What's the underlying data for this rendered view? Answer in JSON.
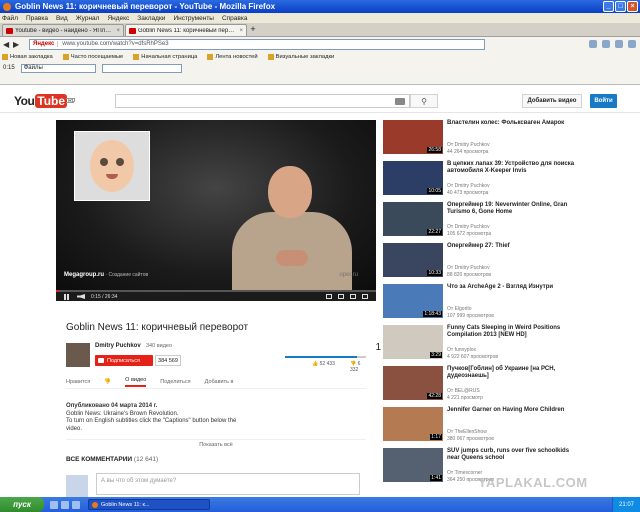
{
  "window": {
    "title": "Goblin News 11: коричневый переворот - YouTube - Mozilla Firefox"
  },
  "menu": [
    "Файл",
    "Правка",
    "Вид",
    "Журнал",
    "Яндекс",
    "Закладки",
    "Инструменты",
    "Справка"
  ],
  "tabs": [
    {
      "label": "Youtube - видео - найдено - ЯПлакалъ"
    },
    {
      "label": "Goblin News 11: коричневый перев..."
    }
  ],
  "address": {
    "badge": "Яндекс",
    "url": "www.youtube.com/watch?v=dfsRhPSe3"
  },
  "bookmarks": [
    "Новая закладка",
    "Часто посещаемые",
    "Начальная страница",
    "Лента новостей",
    "Визуальные закладки"
  ],
  "toolbar2": {
    "field_label": "Файлы",
    "time": "0:15"
  },
  "youtube": {
    "logo": {
      "you": "You",
      "tube": "Tube",
      "locale": "RU"
    },
    "upload_label": "Добавить видео",
    "login_label": "Войти"
  },
  "player": {
    "time": "0:15 / 26:34",
    "brand": "Megagroup.ru",
    "brand_sub": "Создание сайтов",
    "watermark": "oper.ru",
    "progress": 0.01
  },
  "video": {
    "title": "Goblin News 11: коричневый переворот",
    "channel": "Dmitry Puchkov",
    "video_count": "340 видео",
    "subscribe_label": "Подписаться",
    "subscriber_count": "384 569",
    "views": "1 238 833",
    "likes": "52 433",
    "dislikes": "6 332",
    "like_ratio": 0.89
  },
  "actions": [
    "Нравится",
    "О видео",
    "Поделиться",
    "Добавить в"
  ],
  "description": {
    "published": "Опубликовано 04 марта 2014 г.",
    "lines": [
      "Goblin News: Ukraine's Brown Revolution.",
      "To turn on English subtitles click the \"Captions\" button below the",
      "video."
    ],
    "show_more": "Показать всё"
  },
  "comments": {
    "header": "ВСЕ КОММЕНТАРИИ",
    "count": "(12 641)",
    "placeholder": "А вы что об этом думаете?"
  },
  "sidebar": [
    {
      "title": "Властелин колес: Фольксваген Амарок",
      "channel": "От Dmitry Puchkov",
      "views": "44 264 просмотра",
      "duration": "26:58",
      "color": "#9a3a2a"
    },
    {
      "title": "В цепких лапах 39: Устройство для поиска автомобиля X-Keeper Invis",
      "channel": "От Dmitry Puchkov",
      "views": "40 473 просмотра",
      "duration": "10:05",
      "color": "#2c3e66"
    },
    {
      "title": "Опергеймер 19: Neverwinter Online, Gran Turismo 6, Gone Home",
      "channel": "От Dmitry Puchkov",
      "views": "105 672 просмотра",
      "duration": "22:27",
      "color": "#3b4a5a"
    },
    {
      "title": "Опергеймер 27: Thief",
      "channel": "От Dmitry Puchkov",
      "views": "88 820 просмотров",
      "duration": "10:33",
      "color": "#3a4660"
    },
    {
      "title": "Что за ArcheAge 2 - Взгляд Изнутри",
      "channel": "От Elgorito",
      "views": "107 999 просмотров",
      "duration": "1:18:43",
      "color": "#4a7ab8"
    },
    {
      "title": "Funny Cats Sleeping in Weird Positions Compilation 2013 [NEW HD]",
      "channel": "От funnyplox",
      "views": "4 922 607 просмотров",
      "duration": "3:29",
      "color": "#cfc9c0"
    },
    {
      "title": "Пучков[Гоблин] об Украине [на РСН, дудеознаешь]",
      "channel": "От BEL@RUS",
      "views": "4 221 просмотр",
      "duration": "42:28",
      "color": "#8a5040"
    },
    {
      "title": "Jennifer Garner on Having More Children",
      "channel": "От TheEllenShow",
      "views": "380 067 просмотров",
      "duration": "1:17",
      "color": "#b47a52"
    },
    {
      "title": "SUV jumps curb, runs over five schoolkids near Queens school",
      "channel": "От Timescorner",
      "views": "364 250 просмотров",
      "duration": "1:41",
      "color": "#556070"
    }
  ],
  "taskbar": {
    "start": "пуск",
    "item": "Goblin News 11: к...",
    "clock": "21:07"
  },
  "watermark": "YAPLAKAL.COM"
}
